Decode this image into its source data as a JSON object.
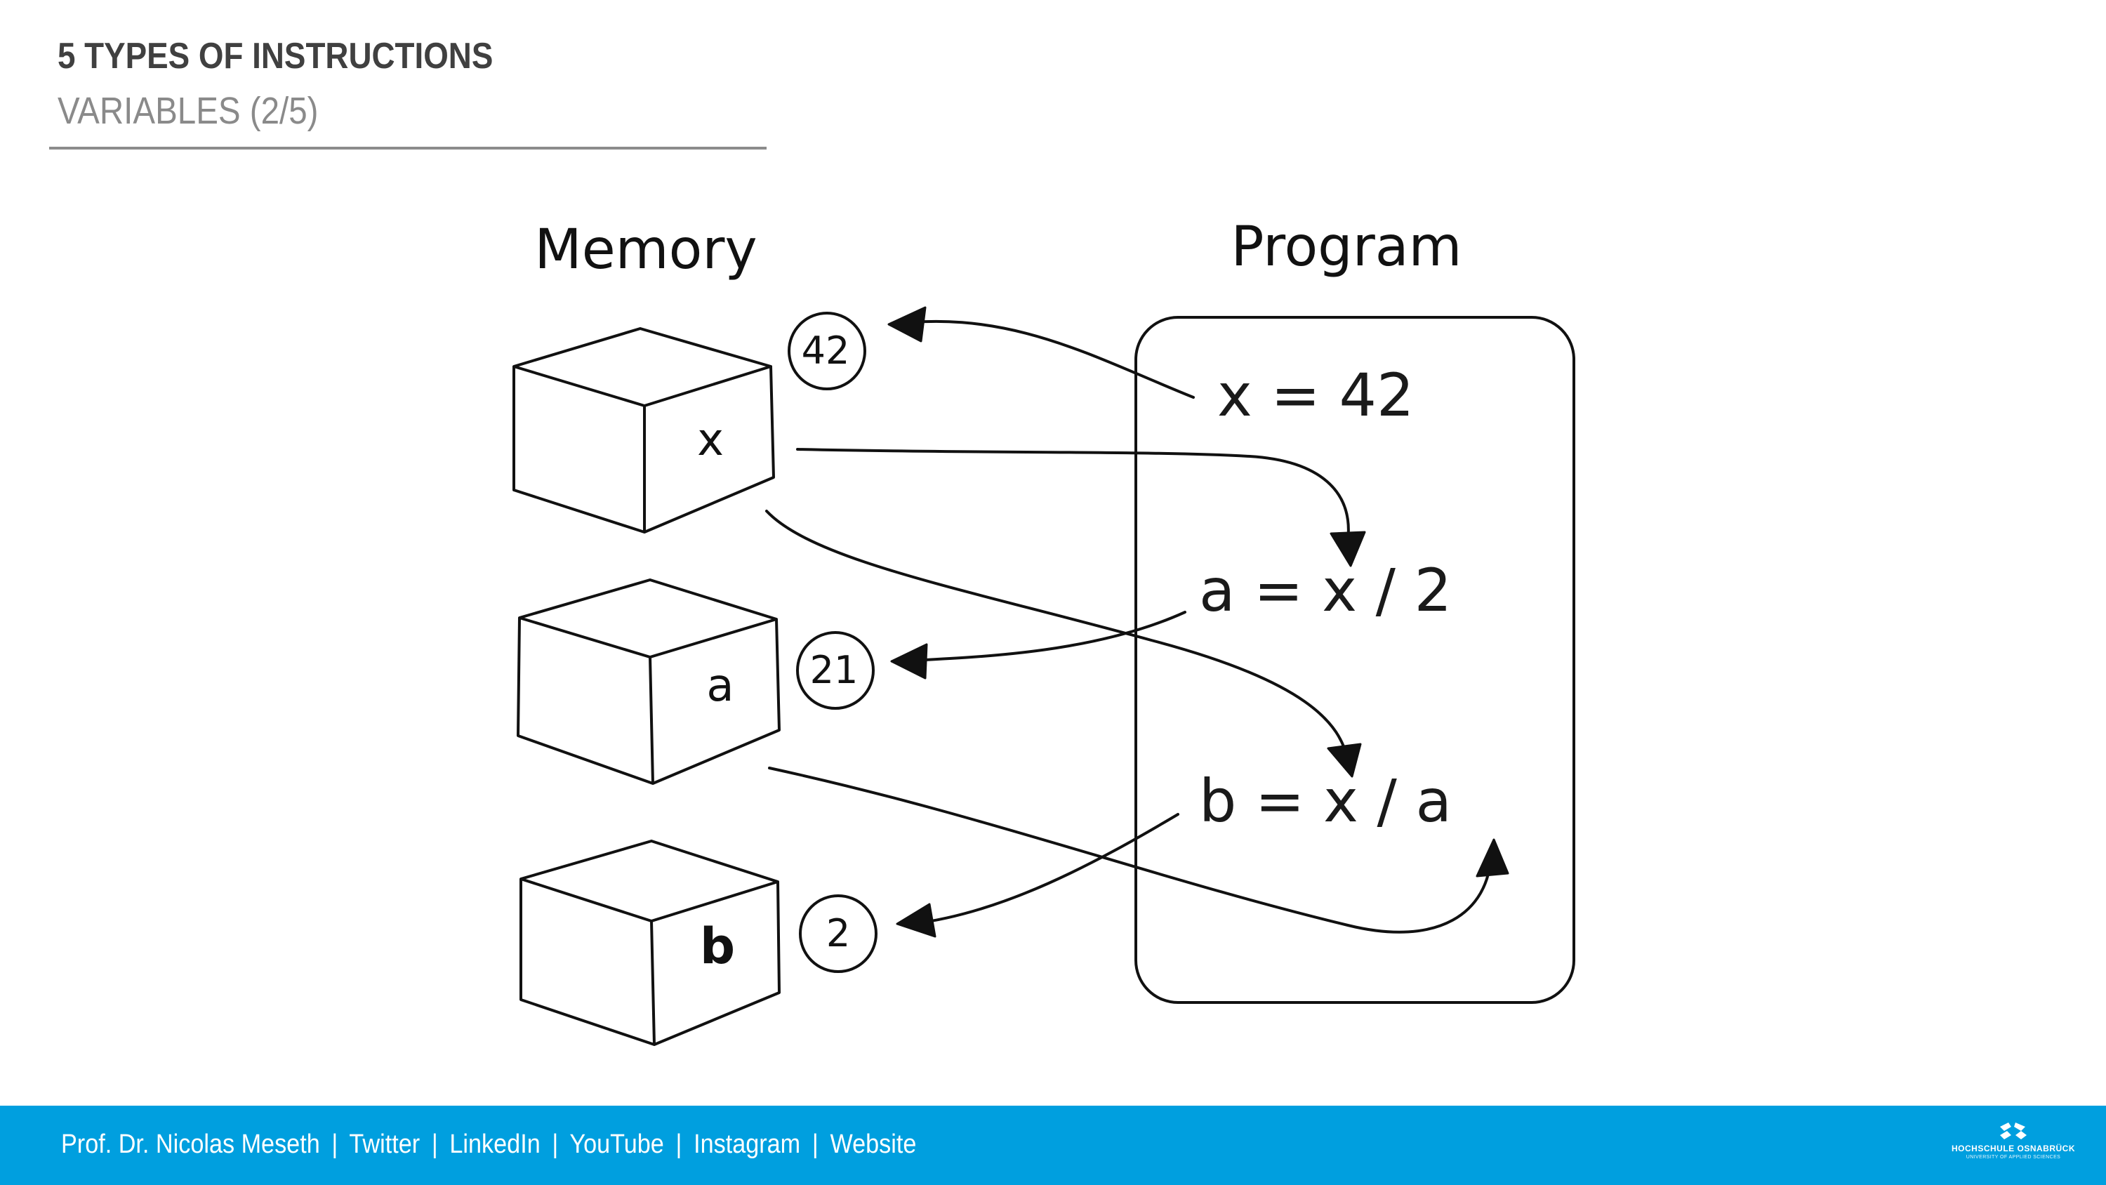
{
  "header": {
    "title": "5 TYPES OF INSTRUCTIONS",
    "subtitle": "VARIABLES (2/5)"
  },
  "diagram": {
    "memory_label": "Memory",
    "program_label": "Program",
    "variables": [
      {
        "name": "x",
        "value": "42"
      },
      {
        "name": "a",
        "value": "21"
      },
      {
        "name": "b",
        "value": "2"
      }
    ],
    "program_lines": [
      "x = 42",
      "a = x / 2",
      "b = x / a"
    ]
  },
  "footer": {
    "author": "Prof. Dr. Nicolas Meseth",
    "separator": "|",
    "links": [
      "Twitter",
      "LinkedIn",
      "YouTube",
      "Instagram",
      "Website"
    ],
    "logo_name": "HOCHSCHULE OSNABRÜCK",
    "logo_sub": "UNIVERSITY OF APPLIED SCIENCES"
  },
  "colors": {
    "footer_bg": "#009fdf",
    "title": "#404040",
    "subtitle": "#8a8a8a",
    "ink": "#111111"
  }
}
